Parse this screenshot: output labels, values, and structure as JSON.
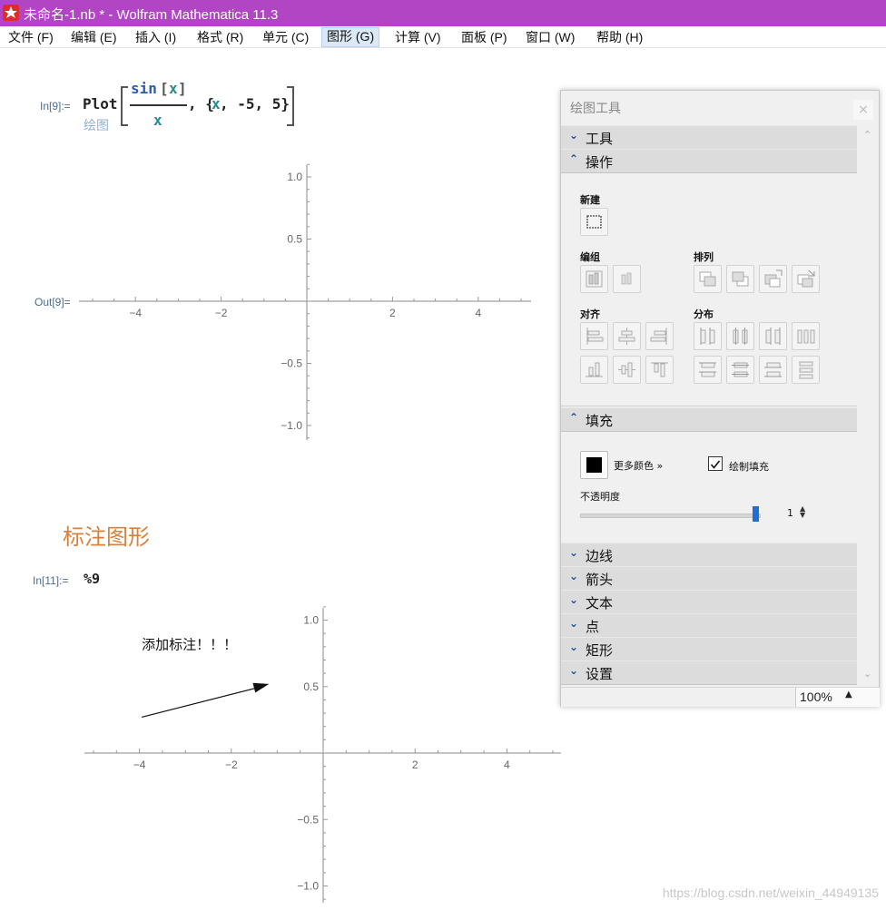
{
  "window": {
    "title": "未命名-1.nb * - Wolfram Mathematica 11.3",
    "icon": "mathematica-icon"
  },
  "menu": [
    {
      "label": "文件 (F)"
    },
    {
      "label": "编辑 (E)"
    },
    {
      "label": "插入 (I)"
    },
    {
      "label": "格式 (R)"
    },
    {
      "label": "单元 (C)"
    },
    {
      "label": "图形 (G)",
      "active": true
    },
    {
      "label": "计算 (V)"
    },
    {
      "label": "面板 (P)"
    },
    {
      "label": "窗口 (W)"
    },
    {
      "label": "帮助 (H)"
    }
  ],
  "notebook": {
    "cell1": {
      "in_label": "In[9]:=",
      "func": "Plot",
      "numer_fn": "sin",
      "numer_arg": "x",
      "denom": "x",
      "range_var": "x",
      "range_rest": ", -5, 5}",
      "hint": "绘图",
      "out_label": "Out[9]="
    },
    "section_title": "标注图形",
    "cell2": {
      "in_label": "In[11]:=",
      "code": "%9"
    },
    "annotation_text": "添加标注！！！"
  },
  "chart_data": [
    {
      "type": "line",
      "title": "",
      "xlabel": "",
      "ylabel": "",
      "xlim": [
        -5.2,
        5.2
      ],
      "ylim": [
        -1.12,
        1.12
      ],
      "x_ticks": [
        "−4",
        "−2",
        "2",
        "4"
      ],
      "y_ticks": [
        "1.0",
        "0.5",
        "−0.5",
        "−1.0"
      ],
      "series": [],
      "grid": false
    },
    {
      "type": "line",
      "title": "",
      "xlim": [
        -5.2,
        5.2
      ],
      "ylim": [
        -1.12,
        1.12
      ],
      "x_ticks": [
        "−4",
        "−2",
        "2",
        "4"
      ],
      "y_ticks": [
        "1.0",
        "0.5",
        "−0.5",
        "−1.0"
      ],
      "annotations": [
        {
          "kind": "text",
          "text": "添加标注！！！",
          "x": -3.95,
          "y": 0.78
        },
        {
          "kind": "arrow",
          "from": [
            -3.95,
            0.27
          ],
          "to": [
            -1.18,
            0.52
          ]
        }
      ],
      "grid": false
    }
  ],
  "palette": {
    "title": "绘图工具",
    "close": "×",
    "sections": {
      "tools": "工具",
      "operations": "操作",
      "fill": "填充",
      "edges": "边线",
      "arrows": "箭头",
      "text": "文本",
      "points": "点",
      "rectangle": "矩形",
      "settings": "设置"
    },
    "labels": {
      "new": "新建",
      "group": "编组",
      "arrange": "排列",
      "align": "对齐",
      "distribute": "分布"
    },
    "fill": {
      "more_colors": "更多颜色 »",
      "draw_fill": "绘制填充",
      "draw_fill_checked": true,
      "opacity_label": "不透明度",
      "opacity_value": "1",
      "opacity_fraction": 1.0,
      "color": "#000000"
    },
    "zoom": "100%"
  },
  "watermark": "https://blog.csdn.net/weixin_44949135",
  "colors": {
    "titlebar": "#b145c3",
    "section_title": "#d9803a",
    "code_blue": "#2b58b5",
    "label_blue": "#4a6e8c",
    "chevron": "#1a4d8f",
    "slider": "#1f6fd6"
  }
}
